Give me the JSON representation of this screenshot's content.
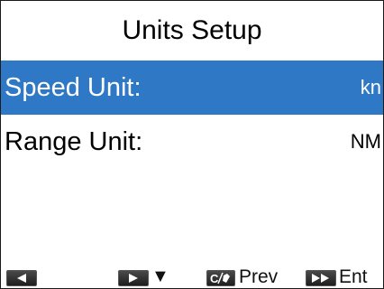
{
  "title": "Units Setup",
  "rows": [
    {
      "label": "Speed Unit:",
      "value": "kn",
      "selected": true
    },
    {
      "label": "Range Unit:",
      "value": "NM",
      "selected": false
    }
  ],
  "footer": {
    "keys": [
      {
        "icon": "left-arrow-key-icon"
      },
      {
        "icon": "right-arrow-key-icon",
        "suffix": "▼"
      },
      {
        "icon": "cancel-key-icon",
        "label": "Prev"
      },
      {
        "icon": "fast-forward-key-icon",
        "label": "Ent"
      }
    ]
  },
  "colors": {
    "selection_bg": "#2e78c6",
    "selection_text": "#ffffff",
    "key_bg": "#2b2b2b"
  }
}
